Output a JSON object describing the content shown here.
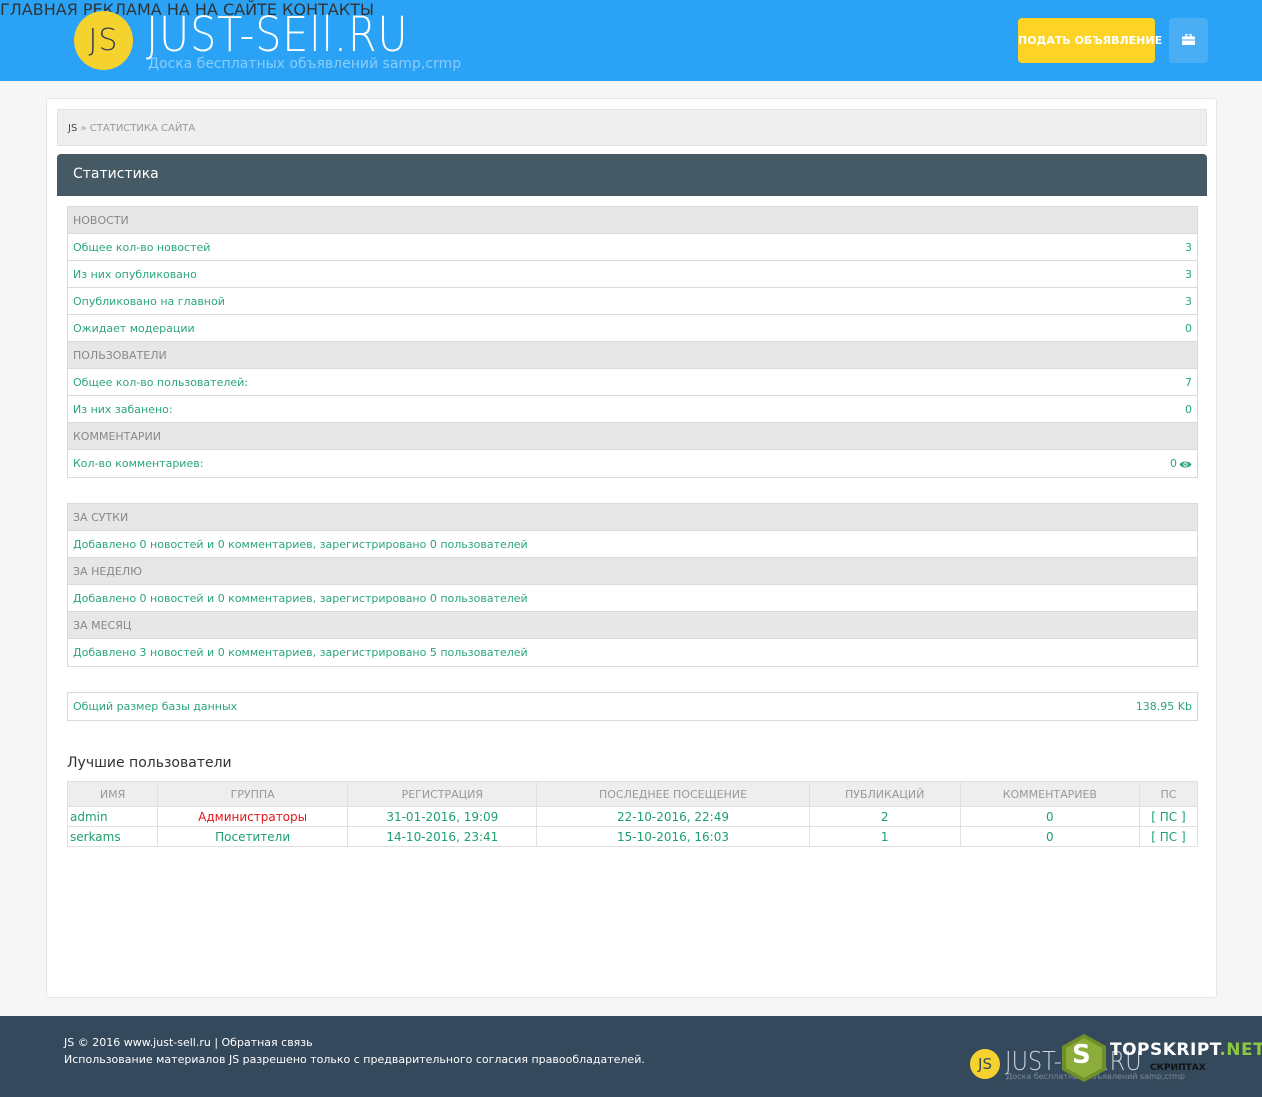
{
  "header": {
    "logo_mark": "JS",
    "logo_title": "JUST-SEll.RU",
    "logo_subtitle": "Доска бесплатных объявлений samp,crmp",
    "nav": [
      "ГЛАВНАЯ",
      "РЕКЛАМА НА НА САЙТЕ",
      "КОНТАКТЫ"
    ],
    "post_button": "ПОДАТЬ ОБЪЯВЛЕНИЕ",
    "bag_icon": "briefcase-icon"
  },
  "breadcrumb": {
    "home": "JS",
    "separator": " » ",
    "current": "СТАТИСТИКА САЙТА"
  },
  "panel_title": "Статистика",
  "news_block": {
    "news_head": "НОВОСТИ",
    "news_rows": [
      {
        "label": "Общее кол-во новостей",
        "value": "3"
      },
      {
        "label": "Из них опубликовано",
        "value": "3"
      },
      {
        "label": "Опубликовано на главной",
        "value": "3"
      },
      {
        "label": "Ожидает модерации",
        "value": "0"
      }
    ],
    "users_head": "ПОЛЬЗОВАТЕЛИ",
    "users_rows": [
      {
        "label": "Общее кол-во пользователей:",
        "value": "7"
      },
      {
        "label": "Из них забанено:",
        "value": "0"
      }
    ],
    "comments_head": "КОММЕНТАРИИ",
    "comments_rows": [
      {
        "label": "Кол-во комментариев:",
        "value": "0"
      }
    ]
  },
  "period_block": {
    "day_head": "ЗА СУТКИ",
    "day_text": "Добавлено 0 новостей и 0 комментариев, зарегистрировано 0 пользователей",
    "week_head": "ЗА НЕДЕЛЮ",
    "week_text": "Добавлено 0 новостей и 0 комментариев, зарегистрировано 0 пользователей",
    "month_head": "ЗА МЕСЯЦ",
    "month_text": "Добавлено 3 новостей и 0 комментариев, зарегистрировано 5 пользователей"
  },
  "db_block": {
    "label": "Общий размер базы данных",
    "value": "138.95 Kb"
  },
  "best_users": {
    "title": "Лучшие пользователи",
    "columns": [
      "ИМЯ",
      "ГРУППА",
      "РЕГИСТРАЦИЯ",
      "ПОСЛЕДНЕЕ ПОСЕЩЕНИЕ",
      "ПУБЛИКАЦИЙ",
      "КОММЕНТАРИЕВ",
      "ПС"
    ],
    "rows": [
      {
        "name": "admin",
        "group": "Администраторы",
        "registered": "31-01-2016, 19:09",
        "last_visit": "22-10-2016, 22:49",
        "posts": "2",
        "comments": "0",
        "pm": "[ ПС ]"
      },
      {
        "name": "serkams",
        "group": "Посетители",
        "registered": "14-10-2016, 23:41",
        "last_visit": "15-10-2016, 16:03",
        "posts": "1",
        "comments": "0",
        "pm": "[ ПС ]"
      }
    ]
  },
  "footer": {
    "line1": "JS © 2016 www.just-sell.ru | Обратная связь",
    "line2": "Использование материалов JS разрешено только с предварительного согласия правообладателей.",
    "logo_mark": "JS",
    "logo_title": "JUST-SEll.RU",
    "logo_subtitle": "Доска бесплатных объявлений samp,crmp",
    "watermark_letter": "S",
    "watermark_name": "TOPSKRIPT",
    "watermark_dot": ".NET",
    "watermark_sub": "СКРИПТАХ"
  },
  "colors": {
    "header_bg": "#2aa3f7",
    "accent_yellow": "#fdd426",
    "panel_header": "#455a64",
    "link_green": "#2aa57f",
    "admin_red": "#e8141b",
    "footer_bg": "#35495c"
  }
}
